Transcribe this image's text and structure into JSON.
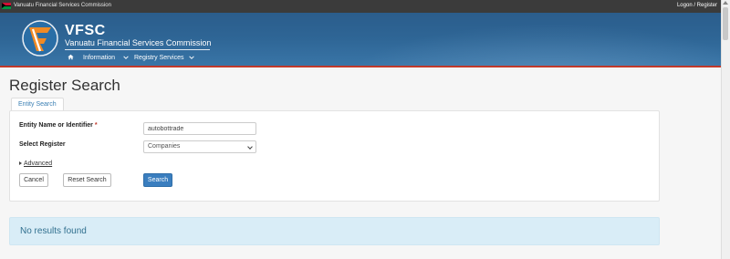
{
  "topbar": {
    "site_name": "Vanuatu Financial Services Commission",
    "logon_label": "Logon / Register"
  },
  "header": {
    "brand_title": "VFSC",
    "brand_subtitle": "Vanuatu Financial Services Commission",
    "nav": {
      "home_icon": "home-icon",
      "items": [
        {
          "label": "Information"
        },
        {
          "label": "Registry Services"
        }
      ]
    }
  },
  "page": {
    "title": "Register Search",
    "tabs": [
      {
        "label": "Entity Search"
      }
    ]
  },
  "form": {
    "entity_label": "Entity Name or Identifier",
    "required_mark": "*",
    "entity_value": "autobottrade",
    "register_label": "Select Register",
    "register_value": "Companies",
    "advanced_label": "Advanced",
    "buttons": {
      "cancel": "Cancel",
      "reset": "Reset Search",
      "search": "Search"
    }
  },
  "results": {
    "message": "No results found"
  },
  "colors": {
    "banner": "#2e6595",
    "accent_red": "#c0392b",
    "primary_button": "#3a7ebf",
    "info_bg": "#d9edf7",
    "info_text": "#31708f"
  }
}
